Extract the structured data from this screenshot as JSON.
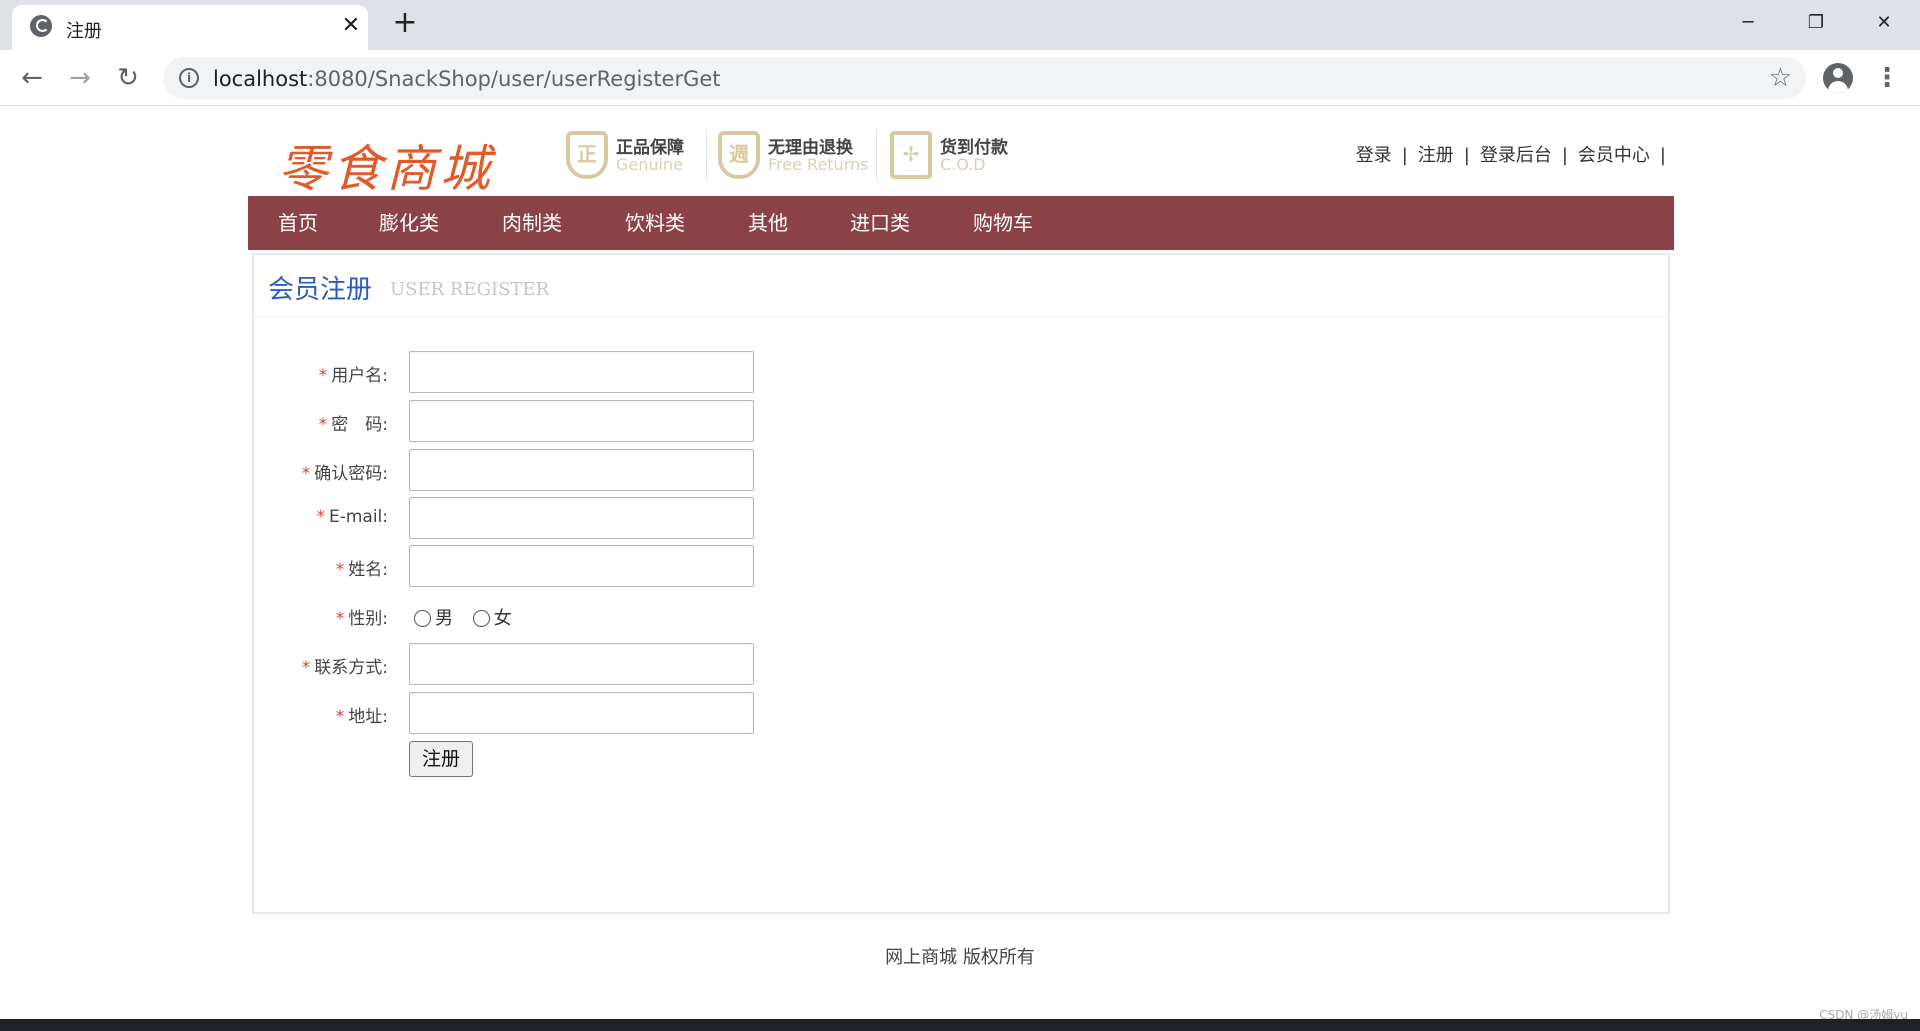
{
  "browser": {
    "tab_title": "注册",
    "url_host": "localhost",
    "url_path": ":8080/SnackShop/user/userRegisterGet"
  },
  "header": {
    "logo": "零食商城",
    "badges": [
      {
        "icon": "正",
        "title": "正品保障",
        "subtitle": "Genuine"
      },
      {
        "icon": "週",
        "title": "无理由退换",
        "subtitle": "Free Returns"
      },
      {
        "icon": "✢",
        "title": "货到付款",
        "subtitle": "C.O.D"
      }
    ],
    "links": [
      "登录",
      "注册",
      "登录后台",
      "会员中心"
    ]
  },
  "nav": {
    "items": [
      "首页",
      "膨化类",
      "肉制类",
      "饮料类",
      "其他",
      "进口类",
      "购物车"
    ]
  },
  "panel": {
    "title": "会员注册",
    "subtitle": "USER REGISTER"
  },
  "form": {
    "required_mark": "*",
    "fields": [
      {
        "label": "用户名:",
        "value": ""
      },
      {
        "label": "密　码:",
        "value": ""
      },
      {
        "label": "确认密码:",
        "value": ""
      },
      {
        "label": "E-mail:",
        "value": ""
      },
      {
        "label": "姓名:",
        "value": ""
      },
      {
        "label": "性别:",
        "options": [
          "男",
          "女"
        ]
      },
      {
        "label": "联系方式:",
        "value": ""
      },
      {
        "label": "地址:",
        "value": ""
      }
    ],
    "submit_label": "注册"
  },
  "footer": {
    "text": "网上商城 版权所有"
  },
  "watermark": "CSDN @汤姆yu"
}
